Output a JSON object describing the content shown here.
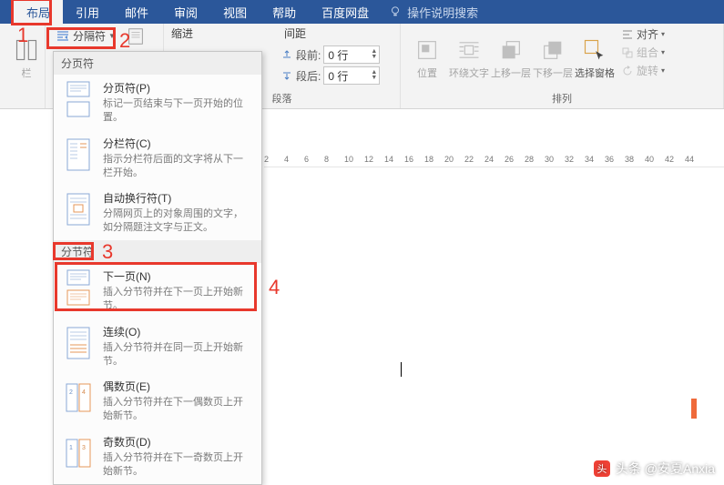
{
  "tabs": {
    "layout": "布局",
    "references": "引用",
    "mail": "邮件",
    "review": "审阅",
    "view": "视图",
    "help": "帮助",
    "baidu": "百度网盘",
    "tellme": "操作说明搜索"
  },
  "ribbon": {
    "columns_char": "栏",
    "breaks_btn": "分隔符",
    "indent_title": "缩进",
    "spacing_title": "间距",
    "before_label": "段前:",
    "after_label": "段后:",
    "before_val": "0 行",
    "after_val": "0 行",
    "group_paragraph": "段落",
    "group_arrange": "排列",
    "position": "位置",
    "wrap": "环绕文字",
    "forward": "上移一层",
    "backward": "下移一层",
    "selectionpane": "选择窗格",
    "align": "对齐",
    "group_btn": "组合",
    "rotate": "旋转"
  },
  "annotations": {
    "n1": "1",
    "n2": "2",
    "n3": "3",
    "n4": "4"
  },
  "breaks_menu": {
    "page_heading": "分页符",
    "section_heading": "分节符",
    "items": [
      {
        "title": "分页符(P)",
        "desc": "标记一页结束与下一页开始的位置。"
      },
      {
        "title": "分栏符(C)",
        "desc": "指示分栏符后面的文字将从下一栏开始。"
      },
      {
        "title": "自动换行符(T)",
        "desc": "分隔网页上的对象周围的文字，如分隔题注文字与正文。"
      },
      {
        "title": "下一页(N)",
        "desc": "插入分节符并在下一页上开始新节。"
      },
      {
        "title": "连续(O)",
        "desc": "插入分节符并在同一页上开始新节。"
      },
      {
        "title": "偶数页(E)",
        "desc": "插入分节符并在下一偶数页上开始新节。"
      },
      {
        "title": "奇数页(D)",
        "desc": "插入分节符并在下一奇数页上开始新节。"
      }
    ]
  },
  "ruler_ticks": [
    "2",
    "4",
    "6",
    "8",
    "10",
    "12",
    "14",
    "16",
    "18",
    "20",
    "22",
    "24",
    "26",
    "28",
    "30",
    "32",
    "34",
    "36",
    "38",
    "40",
    "42",
    "44"
  ],
  "watermark": "头条 @安夏Anxia"
}
